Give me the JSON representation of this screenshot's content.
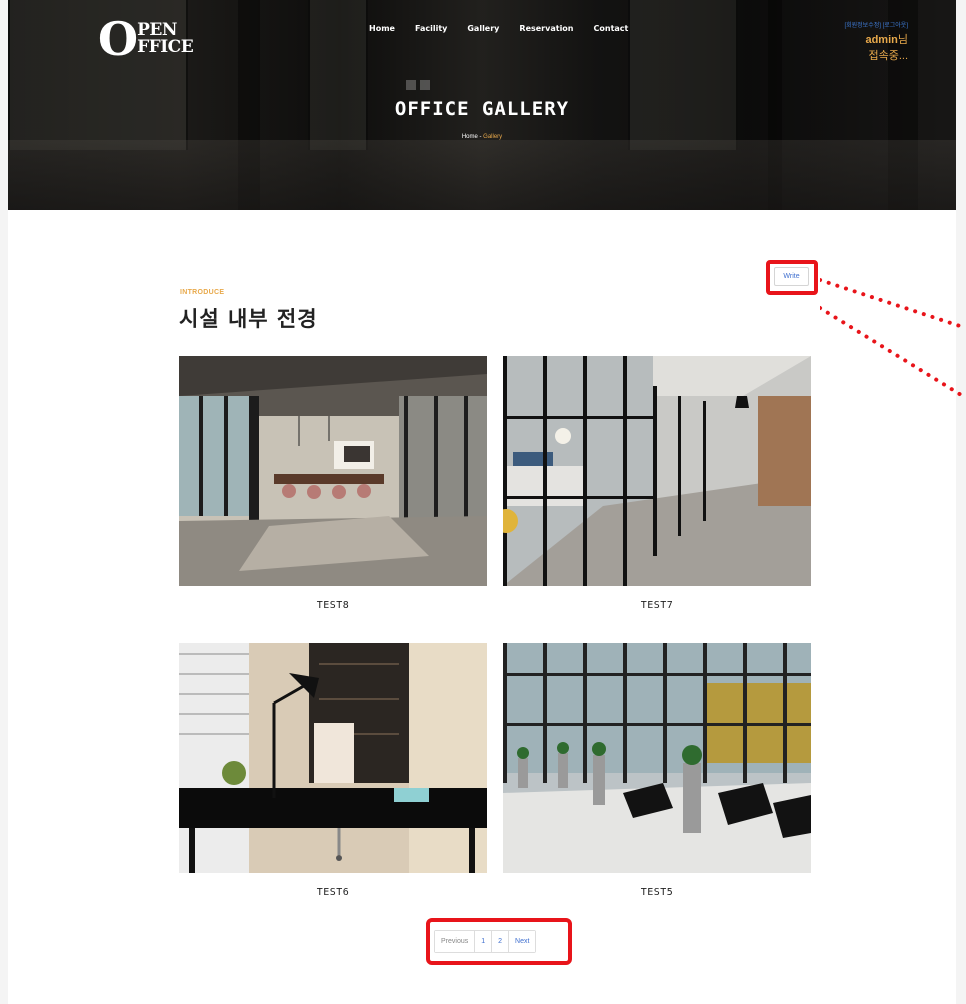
{
  "header": {
    "logo_big": "O",
    "logo_line1": "PEN",
    "logo_line2": "FFICE",
    "nav": [
      "Home",
      "Facility",
      "Gallery",
      "Reservation",
      "Contact"
    ],
    "user_links": "[회원정보수정] [로그아웃]",
    "user_name": "admin",
    "user_name_suffix": "님",
    "user_status": "접속중..."
  },
  "hero": {
    "title": "OFFICE GALLERY",
    "breadcrumb_home": "Home",
    "breadcrumb_sep": "-",
    "breadcrumb_current": "Gallery"
  },
  "content": {
    "write_label": "Write",
    "intro": "INTRODUCE",
    "section_title": "시설 내부 전경",
    "gallery": [
      {
        "caption": "TEST8",
        "image": "office-meeting-room-photo"
      },
      {
        "caption": "TEST7",
        "image": "glass-corridor-photo"
      },
      {
        "caption": "TEST6",
        "image": "desk-with-lamp-photo"
      },
      {
        "caption": "TEST5",
        "image": "lobby-with-chairs-photo"
      }
    ]
  },
  "pagination": {
    "prev": "Previous",
    "pages": [
      "1",
      "2"
    ],
    "next": "Next"
  },
  "colors": {
    "accent": "#e8a94b",
    "link": "#3f6fcf",
    "highlight": "#e8141a"
  }
}
